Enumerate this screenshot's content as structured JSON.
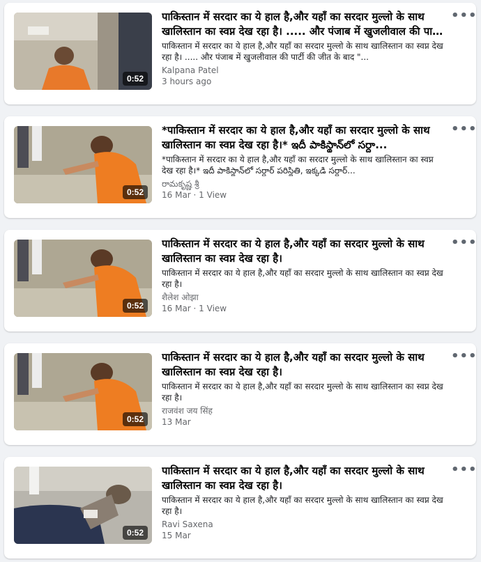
{
  "results": [
    {
      "title": "पाकिस्तान में सरदार का ये हाल है,और यहाँ का सरदार मुल्लो के साथ खालिस्तान का स्वप्न देख रहा है। ..... और पंजाब में खुजलीवाल की पार्टी की जीत के बाद",
      "snippet": "पाकिस्तान में सरदार का ये हाल है,और यहाँ का सरदार मुल्लो के साथ खालिस्तान का स्वप्न देख रहा है। ..... और पंजाब में खुजलीवाल की पार्टी की जीत के बाद \"...",
      "author": "Kalpana Patel",
      "meta": "3 hours ago",
      "duration": "0:52",
      "thumb": "scene-orange-1"
    },
    {
      "title": "*पाकिस्तान में सरदार का ये हाल है,और यहाँ का सरदार मुल्लो के साथ खालिस्तान का स्वप्न देख रहा है।* ఇదీ పాకిస్థాన్‌లో సర్దా...",
      "snippet": "*पाकिस्तान में सरदार का ये हाल है,और यहाँ का सरदार मुल्लो के साथ खालिस्तान का स्वप्न देख रहा है।* ఇదీ పాకిస్థాన్‌లో సర్దార్ పరిస్థితి, ఇక్కడి సర్దార్...",
      "author": "రామకృష్ణ శ్రీ",
      "meta": "16 Mar · 1 View",
      "duration": "0:52",
      "thumb": "scene-orange-2"
    },
    {
      "title": "पाकिस्तान में सरदार का ये हाल है,और यहाँ का सरदार मुल्लो के साथ खालिस्तान का स्वप्न देख रहा है।",
      "snippet": "पाकिस्तान में सरदार का ये हाल है,और यहाँ का सरदार मुल्लो के साथ खालिस्तान का स्वप्न देख रहा है।",
      "author": "शैलेश ओझा",
      "meta": "16 Mar · 1 View",
      "duration": "0:52",
      "thumb": "scene-orange-2"
    },
    {
      "title": "पाकिस्तान में सरदार का ये हाल है,और यहाँ का सरदार मुल्लो के साथ खालिस्तान का स्वप्न देख रहा है।",
      "snippet": "पाकिस्तान में सरदार का ये हाल है,और यहाँ का सरदार मुल्लो के साथ खालिस्तान का स्वप्न देख रहा है।",
      "author": "राजवंश जय सिंह",
      "meta": "13 Mar",
      "duration": "0:52",
      "thumb": "scene-orange-2"
    },
    {
      "title": "पाकिस्तान में सरदार का ये हाल है,और यहाँ का सरदार मुल्लो के साथ खालिस्तान का स्वप्न देख रहा है।",
      "snippet": "पाकिस्तान में सरदार का ये हाल है,और यहाँ का सरदार मुल्लो के साथ खालिस्तान का स्वप्न देख रहा है।",
      "author": "Ravi Saxena",
      "meta": "15 Mar",
      "duration": "0:52",
      "thumb": "scene-ground"
    }
  ],
  "more_icon": "more-horizontal-icon",
  "more_glyph": "•••",
  "colors": {
    "page_bg": "#f0f2f5",
    "card_bg": "#ffffff",
    "meta_text": "#65676b"
  }
}
